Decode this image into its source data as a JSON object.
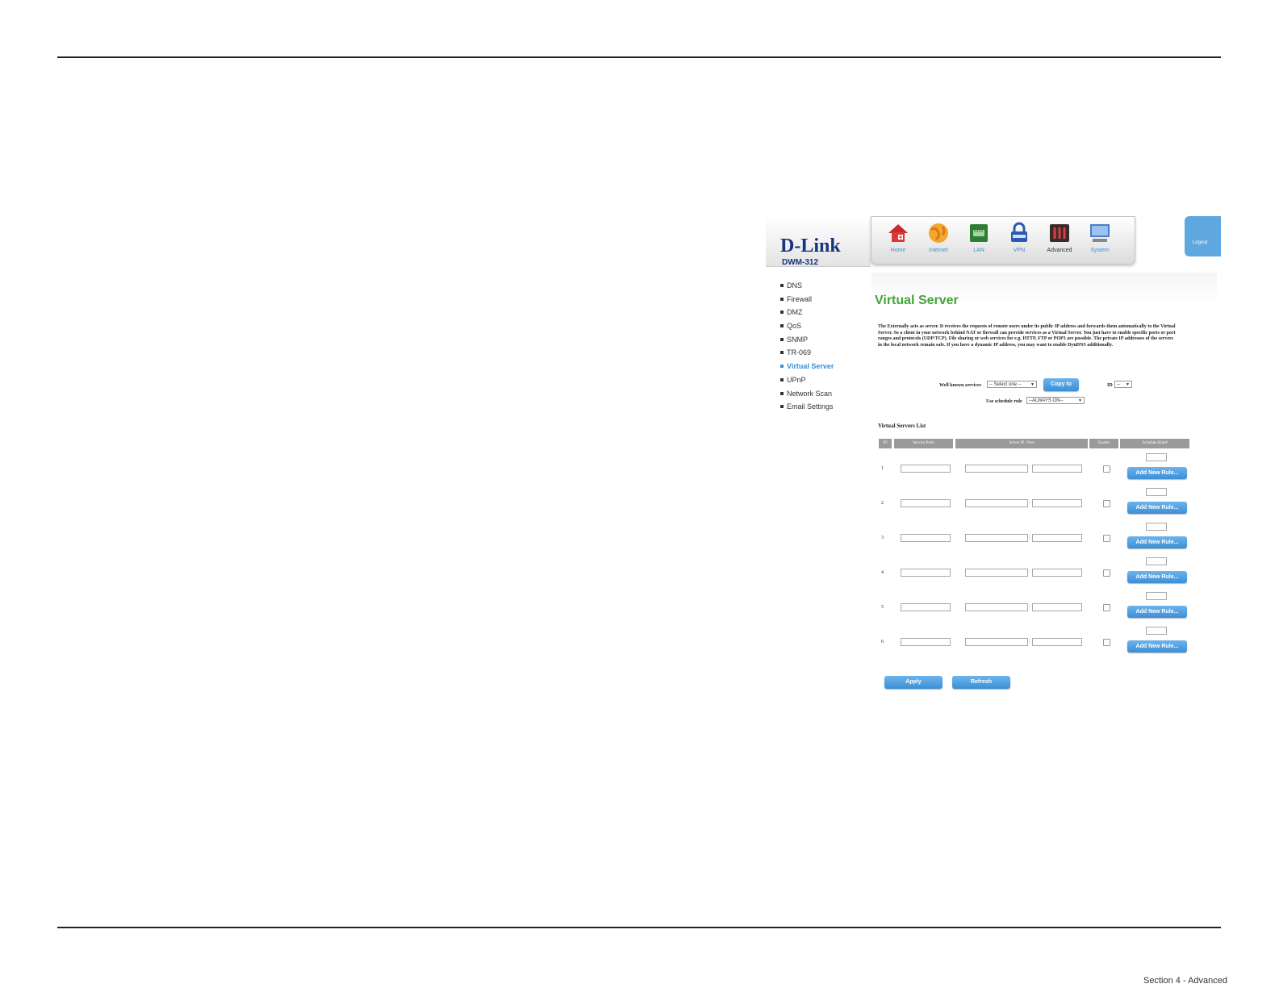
{
  "footer": {
    "text": "Section 4 - Advanced"
  },
  "brand": {
    "logo": "D-Link",
    "model": "DWM-312"
  },
  "nav": [
    {
      "label": "Home",
      "icon": "home-icon"
    },
    {
      "label": "Internet",
      "icon": "globe-icon"
    },
    {
      "label": "LAN",
      "icon": "lan-icon"
    },
    {
      "label": "VPN",
      "icon": "lock-icon"
    },
    {
      "label": "Advanced",
      "icon": "tools-icon"
    },
    {
      "label": "System",
      "icon": "monitor-icon"
    }
  ],
  "logout": "Logout",
  "sidebar": [
    {
      "label": "DNS"
    },
    {
      "label": "Firewall"
    },
    {
      "label": "DMZ"
    },
    {
      "label": "QoS"
    },
    {
      "label": "SNMP"
    },
    {
      "label": "TR-069"
    },
    {
      "label": "Virtual Server"
    },
    {
      "label": "UPnP"
    },
    {
      "label": "Network Scan"
    },
    {
      "label": "Email Settings"
    }
  ],
  "page": {
    "title": "Virtual Server",
    "description": "The Externally acts as server. It receives the requests of remote users under its public IP address and forwards them automatically to the Virtual Server. So a client in your network behind NAT or firewall can provide services as a Virtual Server. You just have to enable specific ports or port ranges and protocols (UDP/TCP). File sharing or web services for e.g. HTTP, FTP or POP3 are possible. The private IP addresses of the servers in the local network remain safe. If you have a dynamic IP address, you may want to enable DynDNS additionally.",
    "well_known_label": "Well known services",
    "well_known_value": "-- Select one --",
    "copy_to": "Copy to",
    "id_label": "ID",
    "id_value": "--",
    "schedule_label": "Use schedule rule",
    "schedule_value": "--ALWAYS ON--",
    "list_title": "Virtual Servers List",
    "columns": [
      "ID",
      "Service Ports",
      "Server IP : Port",
      "Enable",
      "Schedule Rule#"
    ],
    "rows": [
      {
        "id": "1",
        "add": "Add New Rule..."
      },
      {
        "id": "2",
        "add": "Add New Rule..."
      },
      {
        "id": "3",
        "add": "Add New Rule..."
      },
      {
        "id": "4",
        "add": "Add New Rule..."
      },
      {
        "id": "5",
        "add": "Add New Rule..."
      },
      {
        "id": "6",
        "add": "Add New Rule..."
      }
    ],
    "apply": "Apply",
    "refresh": "Refresh"
  },
  "colors": {
    "accent": "#3a8fd6",
    "title_green": "#43a43a",
    "brand_navy": "#16357a"
  }
}
